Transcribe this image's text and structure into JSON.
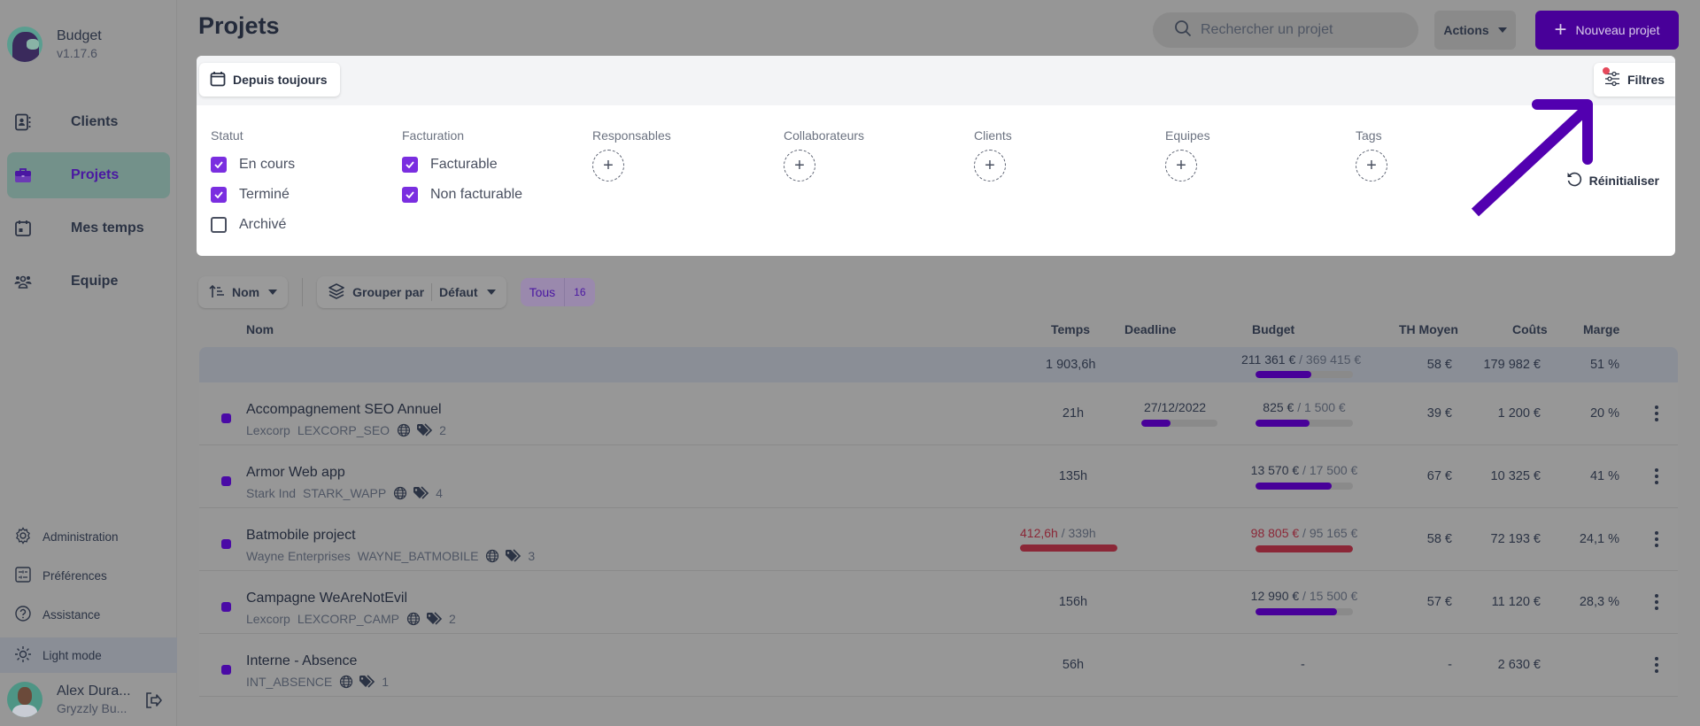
{
  "app": {
    "name": "Budget",
    "version": "v1.17.6"
  },
  "sidebar": {
    "items": [
      {
        "label": "Clients",
        "icon": "contacts-book-icon",
        "active": false
      },
      {
        "label": "Projets",
        "icon": "briefcase-icon",
        "active": true
      },
      {
        "label": "Mes temps",
        "icon": "calendar-icon",
        "active": false
      },
      {
        "label": "Equipe",
        "icon": "team-icon",
        "active": false
      }
    ],
    "bottom_items": [
      {
        "label": "Administration",
        "icon": "gear-icon"
      },
      {
        "label": "Préférences",
        "icon": "sliders-icon"
      },
      {
        "label": "Assistance",
        "icon": "help-circle-icon"
      },
      {
        "label": "Light mode",
        "icon": "sun-icon"
      }
    ],
    "user": {
      "name": "Alex Dura...",
      "org": "Gryzzly Bu..."
    }
  },
  "header": {
    "title": "Projets",
    "search_placeholder": "Rechercher un projet",
    "actions_label": "Actions",
    "new_project_label": "Nouveau projet"
  },
  "filters": {
    "date_label": "Depuis toujours",
    "filters_label": "Filtres",
    "reset_label": "Réinitialiser",
    "active_indicator_color": "#e5495b",
    "statut": {
      "title": "Statut",
      "options": [
        {
          "label": "En cours",
          "checked": true
        },
        {
          "label": "Terminé",
          "checked": true
        },
        {
          "label": "Archivé",
          "checked": false
        }
      ]
    },
    "facturation": {
      "title": "Facturation",
      "options": [
        {
          "label": "Facturable",
          "checked": true
        },
        {
          "label": "Non facturable",
          "checked": true
        }
      ]
    },
    "pickers": [
      "Responsables",
      "Collaborateurs",
      "Clients",
      "Equipes",
      "Tags"
    ]
  },
  "toolbar": {
    "sort_label": "Nom",
    "group_label": "Grouper par",
    "group_value": "Défaut",
    "tab_label": "Tous",
    "tab_count": "16"
  },
  "table": {
    "columns": [
      "Nom",
      "Temps",
      "Deadline",
      "Budget",
      "TH Moyen",
      "Coûts",
      "Marge"
    ],
    "summary": {
      "temps": "1 903,6h",
      "budget_spent": "211 361 €",
      "budget_total": "369 415 €",
      "budget_progress": 0.57,
      "th": "58 €",
      "couts": "179 982 €",
      "marge": "51 %"
    },
    "rows": [
      {
        "name": "Accompagnement SEO Annuel",
        "client": "Lexcorp",
        "code": "LEXCORP_SEO",
        "tags": "2",
        "temps": "21h",
        "temps_over": false,
        "deadline": "27/12/2022",
        "deadline_progress": 0.38,
        "budget_spent": "825 €",
        "budget_total": "1 500 €",
        "budget_progress": 0.55,
        "budget_over": false,
        "th": "39 €",
        "couts": "1 200 €",
        "marge": "20 %"
      },
      {
        "name": "Armor Web app",
        "client": "Stark Ind",
        "code": "STARK_WAPP",
        "tags": "4",
        "temps": "135h",
        "temps_over": false,
        "deadline": "",
        "deadline_progress": null,
        "budget_spent": "13 570 €",
        "budget_total": "17 500 €",
        "budget_progress": 0.78,
        "budget_over": false,
        "th": "67 €",
        "couts": "10 325 €",
        "marge": "41 %"
      },
      {
        "name": "Batmobile project",
        "client": "Wayne Enterprises",
        "code": "WAYNE_BATMOBILE",
        "tags": "3",
        "temps": "412,6h",
        "temps_total": "339h",
        "temps_over": true,
        "temps_progress": 1.0,
        "deadline": "",
        "deadline_progress": null,
        "budget_spent": "98 805 €",
        "budget_total": "95 165 €",
        "budget_progress": 1.0,
        "budget_over": true,
        "th": "58 €",
        "couts": "72 193 €",
        "marge": "24,1 %"
      },
      {
        "name": "Campagne WeAreNotEvil",
        "client": "Lexcorp",
        "code": "LEXCORP_CAMP",
        "tags": "2",
        "temps": "156h",
        "temps_over": false,
        "deadline": "",
        "deadline_progress": null,
        "budget_spent": "12 990 €",
        "budget_total": "15 500 €",
        "budget_progress": 0.84,
        "budget_over": false,
        "th": "57 €",
        "couts": "11 120 €",
        "marge": "28,3 %"
      },
      {
        "name": "Interne - Absence",
        "client": "",
        "code": "INT_ABSENCE",
        "tags": "1",
        "temps": "56h",
        "temps_over": false,
        "deadline": "",
        "deadline_progress": null,
        "budget_empty": "-",
        "budget_progress": null,
        "th": "-",
        "couts": "2 630 €",
        "marge": ""
      }
    ]
  },
  "colors": {
    "accent": "#480099",
    "over_budget": "#8b2737",
    "checkbox": "#7a2ee0"
  }
}
